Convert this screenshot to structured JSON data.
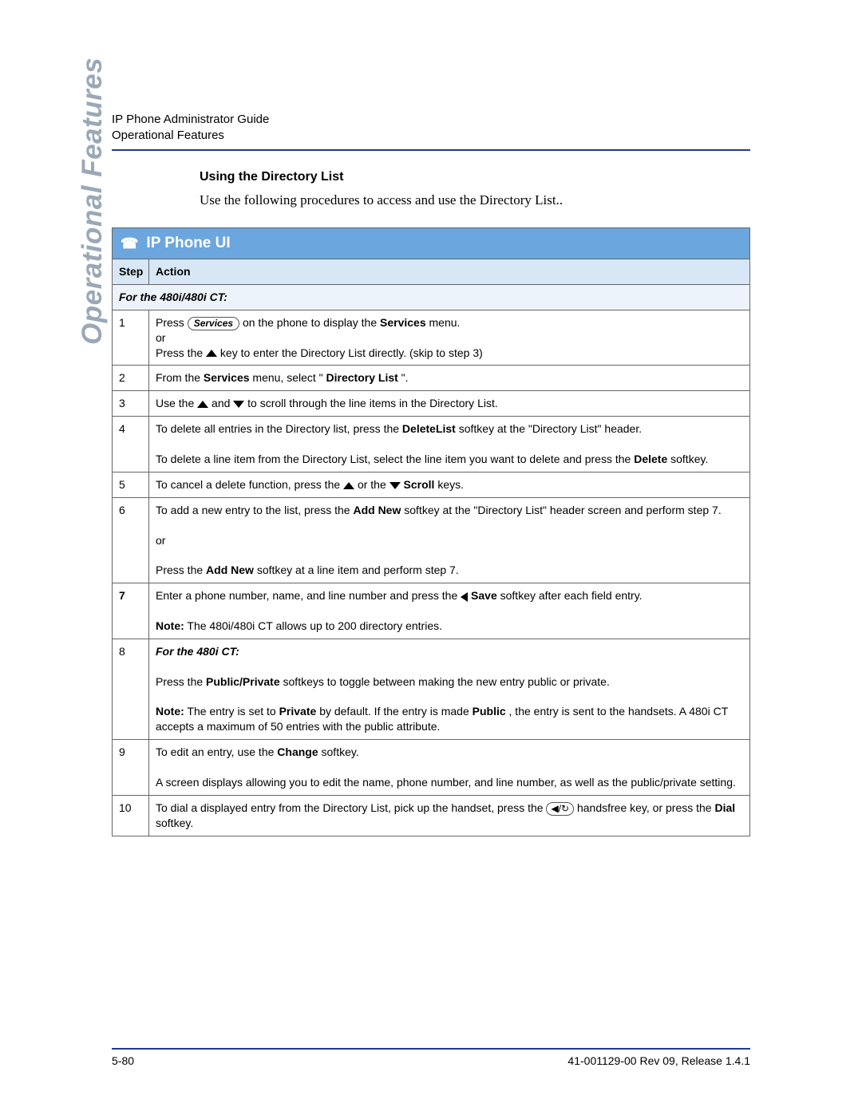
{
  "header": {
    "line1": "IP Phone Administrator Guide",
    "line2": "Operational Features"
  },
  "vertical_tab": "Operational Features",
  "section": {
    "title": "Using the Directory List",
    "intro": "Use the following procedures to access and use the Directory List.."
  },
  "procedure": {
    "title": "IP Phone UI",
    "columns": {
      "step": "Step",
      "action": "Action"
    },
    "subhead": "For the 480i/480i CT:",
    "steps": {
      "s1": {
        "num": "1",
        "t1": "Press ",
        "key_label": "Services",
        "t2": " on the phone to display the ",
        "b1": "Services",
        "t3": " menu.",
        "t4": "or",
        "t5": "Press the ",
        "t6": " key to enter the Directory List directly. (skip to step 3)"
      },
      "s2": {
        "num": "2",
        "t1": "From the ",
        "b1": "Services",
        "t2": " menu, select \"",
        "b2": "Directory List",
        "t3": "\"."
      },
      "s3": {
        "num": "3",
        "t1": "Use the ",
        "t2": " and ",
        "t3": " to scroll through the line items in the Directory List."
      },
      "s4": {
        "num": "4",
        "t1": "To delete all entries in the Directory list, press the ",
        "b1": "DeleteList",
        "t2": " softkey at the \"Directory List\" header.",
        "t3": "To delete a line item from the Directory List, select the line item you want to delete and press the ",
        "b2": "Delete",
        "t4": " softkey."
      },
      "s5": {
        "num": "5",
        "t1": "To cancel a delete function, press the ",
        "t2": " or the ",
        "b1": "Scroll",
        "t3": " keys."
      },
      "s6": {
        "num": "6",
        "t1": "To add a new entry to the list, press the ",
        "b1": "Add New",
        "t2": " softkey at the \"Directory List\" header screen and perform step 7.",
        "t3": "or",
        "t4": "Press the ",
        "b2": "Add New",
        "t5": " softkey at a line item and perform step 7."
      },
      "s7": {
        "num": "7",
        "t1": "Enter a phone number, name, and line number and press the ",
        "b1": "Save",
        "t2": " softkey after each field entry.",
        "b2": "Note:",
        "t3": " The 480i/480i CT allows up to 200 directory entries."
      },
      "s8": {
        "num": "8",
        "sub": "For the 480i CT:",
        "t1": "Press the ",
        "b1": "Public/Private",
        "t2": " softkeys to toggle between making the new entry public or private.",
        "b2": "Note:",
        "t3": " The entry is set to ",
        "b3": "Private",
        "t4": " by default. If the entry is made ",
        "b4": "Public",
        "t5": ", the entry is sent to the handsets. A 480i CT accepts a maximum of 50 entries with the public attribute."
      },
      "s9": {
        "num": "9",
        "t1": "To edit an entry, use the ",
        "b1": "Change",
        "t2": " softkey.",
        "t3": "A screen displays allowing you to edit the name, phone number, and line number, as well as the public/private setting."
      },
      "s10": {
        "num": "10",
        "t1": "To dial a displayed entry from the Directory List, pick up the handset, press the ",
        "t2": " handsfree key, or press the ",
        "b1": "Dial",
        "t3": " softkey."
      }
    }
  },
  "footer": {
    "left": "5-80",
    "right": "41-001129-00 Rev 09, Release 1.4.1"
  },
  "icons": {
    "phone": "☎",
    "handsfree": "◀/↻"
  }
}
